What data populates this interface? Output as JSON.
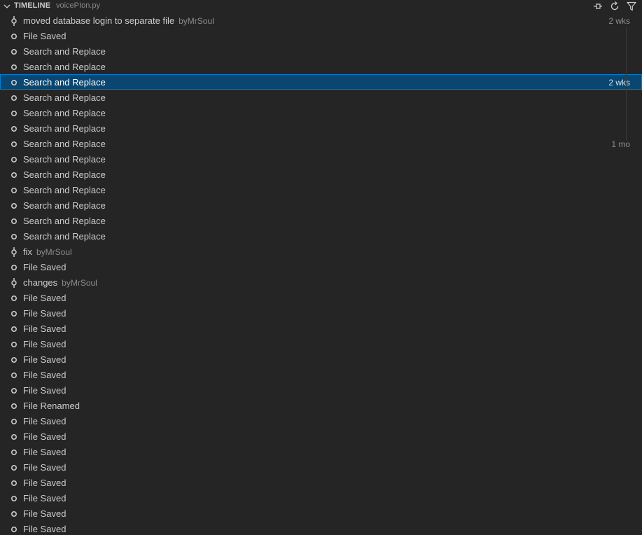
{
  "header": {
    "title": "TIMELINE",
    "file": "voicePIon.py"
  },
  "colors": {
    "background": "#252526",
    "selection": "#094771",
    "selection_border": "#007fd4",
    "text": "#cccccc",
    "muted": "#8b8b8b"
  },
  "items": [
    {
      "type": "commit",
      "label": "moved database login to separate file",
      "author": "byMrSoul",
      "time": "2 wks"
    },
    {
      "type": "local",
      "label": "File Saved",
      "author": "",
      "time": ""
    },
    {
      "type": "local",
      "label": "Search and Replace",
      "author": "",
      "time": ""
    },
    {
      "type": "local",
      "label": "Search and Replace",
      "author": "",
      "time": ""
    },
    {
      "type": "local",
      "label": "Search and Replace",
      "author": "",
      "time": "2 wks",
      "selected": true
    },
    {
      "type": "local",
      "label": "Search and Replace",
      "author": "",
      "time": ""
    },
    {
      "type": "local",
      "label": "Search and Replace",
      "author": "",
      "time": ""
    },
    {
      "type": "local",
      "label": "Search and Replace",
      "author": "",
      "time": ""
    },
    {
      "type": "local",
      "label": "Search and Replace",
      "author": "",
      "time": "1 mo"
    },
    {
      "type": "local",
      "label": "Search and Replace",
      "author": "",
      "time": ""
    },
    {
      "type": "local",
      "label": "Search and Replace",
      "author": "",
      "time": ""
    },
    {
      "type": "local",
      "label": "Search and Replace",
      "author": "",
      "time": ""
    },
    {
      "type": "local",
      "label": "Search and Replace",
      "author": "",
      "time": ""
    },
    {
      "type": "local",
      "label": "Search and Replace",
      "author": "",
      "time": ""
    },
    {
      "type": "local",
      "label": "Search and Replace",
      "author": "",
      "time": ""
    },
    {
      "type": "commit",
      "label": "fix",
      "author": "byMrSoul",
      "time": ""
    },
    {
      "type": "local",
      "label": "File Saved",
      "author": "",
      "time": ""
    },
    {
      "type": "commit",
      "label": "changes",
      "author": "byMrSoul",
      "time": ""
    },
    {
      "type": "local",
      "label": "File Saved",
      "author": "",
      "time": ""
    },
    {
      "type": "local",
      "label": "File Saved",
      "author": "",
      "time": ""
    },
    {
      "type": "local",
      "label": "File Saved",
      "author": "",
      "time": ""
    },
    {
      "type": "local",
      "label": "File Saved",
      "author": "",
      "time": ""
    },
    {
      "type": "local",
      "label": "File Saved",
      "author": "",
      "time": ""
    },
    {
      "type": "local",
      "label": "File Saved",
      "author": "",
      "time": ""
    },
    {
      "type": "local",
      "label": "File Saved",
      "author": "",
      "time": ""
    },
    {
      "type": "local",
      "label": "File Renamed",
      "author": "",
      "time": ""
    },
    {
      "type": "local",
      "label": "File Saved",
      "author": "",
      "time": ""
    },
    {
      "type": "local",
      "label": "File Saved",
      "author": "",
      "time": ""
    },
    {
      "type": "local",
      "label": "File Saved",
      "author": "",
      "time": ""
    },
    {
      "type": "local",
      "label": "File Saved",
      "author": "",
      "time": ""
    },
    {
      "type": "local",
      "label": "File Saved",
      "author": "",
      "time": ""
    },
    {
      "type": "local",
      "label": "File Saved",
      "author": "",
      "time": ""
    },
    {
      "type": "local",
      "label": "File Saved",
      "author": "",
      "time": ""
    },
    {
      "type": "local",
      "label": "File Saved",
      "author": "",
      "time": ""
    }
  ]
}
